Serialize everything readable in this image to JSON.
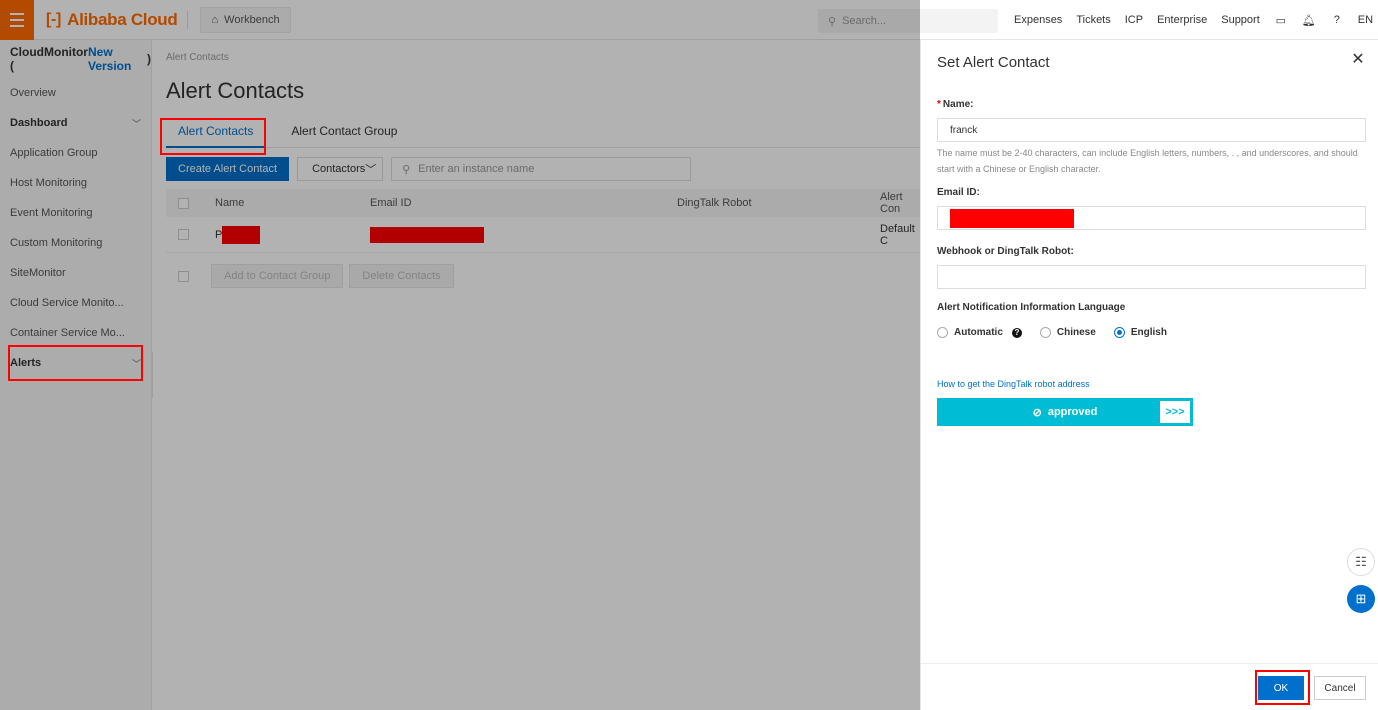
{
  "topbar": {
    "brand": "Alibaba Cloud",
    "workbench_label": "Workbench",
    "search_placeholder": "Search...",
    "links": [
      "Expenses",
      "Tickets",
      "ICP",
      "Enterprise",
      "Support"
    ],
    "language": "EN"
  },
  "sidebar": {
    "title_prefix": "CloudMonitor (",
    "title_new": "New Version",
    "title_suffix": ")",
    "items": [
      {
        "label": "Overview"
      },
      {
        "label": "Dashboard"
      },
      {
        "label": "Application Group"
      },
      {
        "label": "Host Monitoring"
      },
      {
        "label": "Event Monitoring"
      },
      {
        "label": "Custom Monitoring"
      },
      {
        "label": "SiteMonitor"
      },
      {
        "label": "Cloud Service Monito..."
      },
      {
        "label": "Container Service Mo..."
      },
      {
        "label": "Alerts"
      }
    ]
  },
  "main": {
    "breadcrumb": "Alert Contacts",
    "title": "Alert Contacts",
    "tabs": [
      "Alert Contacts",
      "Alert Contact Group"
    ],
    "create_button": "Create Alert Contact",
    "contactors_select": "Contactors",
    "instance_search_placeholder": "Enter an instance name",
    "columns": [
      "Name",
      "Email ID",
      "DingTalk Robot",
      "Alert Con"
    ],
    "rows": [
      {
        "name_prefix": "P",
        "alert_contact": "Default C"
      }
    ],
    "add_to_group_button": "Add to Contact Group",
    "delete_button": "Delete Contacts"
  },
  "drawer": {
    "title": "Set Alert Contact",
    "name_required": "*",
    "name_label": "Name:",
    "name_value": "franck",
    "name_hint": "The name must be 2-40 characters, can include English letters, numbers, . , and underscores, and should start with a Chinese or English character.",
    "email_label": "Email ID:",
    "webhook_label": "Webhook or DingTalk Robot:",
    "language_label": "Alert Notification Information Language",
    "language_options": [
      "Automatic",
      "Chinese",
      "English"
    ],
    "language_selected": "English",
    "dingtalk_link": "How to get the DingTalk robot address",
    "approved_label": "approved",
    "approved_handle": ">>>",
    "ok_button": "OK",
    "cancel_button": "Cancel"
  },
  "colors": {
    "brand_orange": "#ff6a00",
    "primary_blue": "#0070cc",
    "approved_cyan": "#00bcd4",
    "annotation_red": "#ff0000"
  },
  "icons": [
    "menu-icon",
    "home-icon",
    "search-icon",
    "terminal-icon",
    "bell-icon",
    "help-icon",
    "close-icon",
    "check-circle-icon",
    "feedback-icon",
    "apps-icon"
  ]
}
